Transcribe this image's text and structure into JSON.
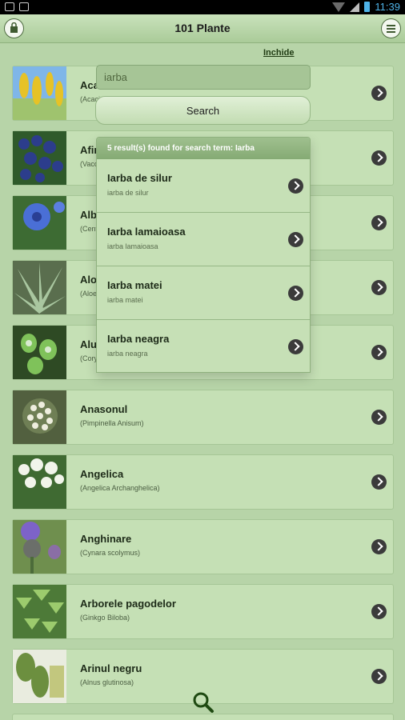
{
  "status_bar": {
    "time": "11:39"
  },
  "header": {
    "title": "101 Plante"
  },
  "close_link": "Inchide",
  "search": {
    "value": "iarba",
    "button_label": "Search"
  },
  "results": {
    "header": "5 result(s) found for search term: Iarba",
    "items": [
      {
        "name": "Iarba de silur",
        "sub": "iarba de silur"
      },
      {
        "name": "Iarba lamaioasa",
        "sub": "iarba lamaioasa"
      },
      {
        "name": "Iarba matei",
        "sub": "iarba matei"
      },
      {
        "name": "Iarba neagra",
        "sub": "iarba neagra"
      }
    ]
  },
  "plants": [
    {
      "name": "Acacia",
      "latin": "(Acacia senegal)",
      "thumb": "yellow-flowers"
    },
    {
      "name": "Afine",
      "latin": "(Vaccinium myrtillus)",
      "thumb": "blueberries"
    },
    {
      "name": "Albastrele",
      "latin": "(Centaurea cyanus)",
      "thumb": "blue-flower"
    },
    {
      "name": "Aloe",
      "latin": "(Aloe vera)",
      "thumb": "aloe"
    },
    {
      "name": "Aluna",
      "latin": "(Corylus avellana)",
      "thumb": "green-buds"
    },
    {
      "name": "Anasonul",
      "latin": "(Pimpinella Anisum)",
      "thumb": "white-umbels"
    },
    {
      "name": "Angelica",
      "latin": "(Angelica Archanghelica)",
      "thumb": "white-spheres"
    },
    {
      "name": "Anghinare",
      "latin": "(Cynara scolymus)",
      "thumb": "artichoke"
    },
    {
      "name": "Arborele pagodelor",
      "latin": "(Ginkgo Biloba)",
      "thumb": "ginkgo"
    },
    {
      "name": "Arinul negru",
      "latin": "(Alnus glutinosa)",
      "thumb": "alder-leaves"
    }
  ],
  "colors": {
    "background": "#b7d4a8",
    "row": "#c5e0b5",
    "header_bar": "#85aa74"
  }
}
